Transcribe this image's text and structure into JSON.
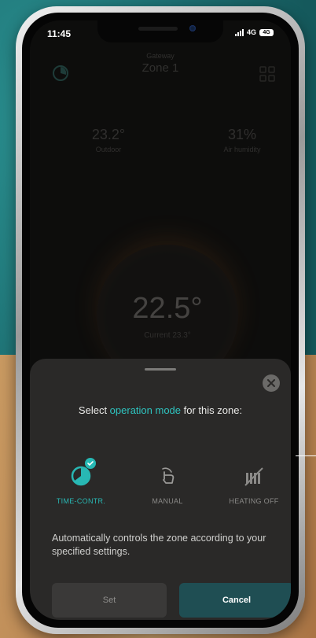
{
  "status": {
    "time": "11:45",
    "network": "4G",
    "battery": "4G"
  },
  "header": {
    "subtitle": "Gateway",
    "zone": "Zone 1"
  },
  "stats": [
    {
      "value": "23.2°",
      "label": "Outdoor"
    },
    {
      "value": "31%",
      "label": "Air humidity"
    }
  ],
  "dial": {
    "temperature": "22.5°",
    "current": "Current 23.3°"
  },
  "sheet": {
    "title_before": "Select ",
    "title_accent": "operation mode",
    "title_after": " for this zone:",
    "modes": [
      {
        "label": "TIME-CONTR.",
        "selected": true
      },
      {
        "label": "MANUAL",
        "selected": false
      },
      {
        "label": "HEATING OFF",
        "selected": false
      }
    ],
    "description": "Automatically controls the zone according to your specified settings.",
    "set_label": "Set",
    "cancel_label": "Cancel"
  },
  "colors": {
    "accent": "#2ec4c0",
    "cancel_bg": "#1f4e53",
    "sheet_bg": "#2a2928"
  }
}
